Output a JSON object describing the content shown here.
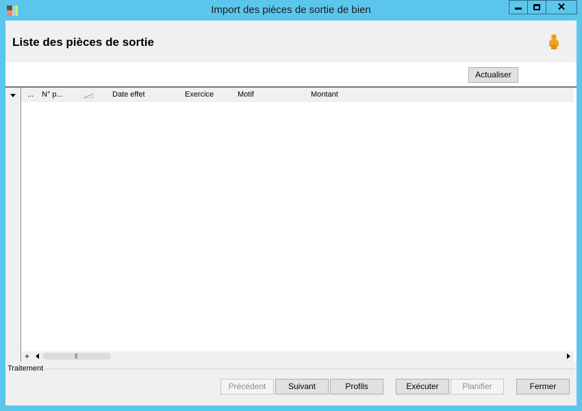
{
  "window": {
    "title": "Import des pièces de sortie de bien",
    "close_glyph": "✕"
  },
  "header": {
    "title": "Liste des pièces de sortie",
    "user_icon": "user-icon"
  },
  "toolbar": {
    "refresh_label": "Actualiser"
  },
  "grid": {
    "columns": [
      "...",
      "N° p...",
      "Date effet",
      "Exercice",
      "Motif",
      "Montant"
    ],
    "rows": [],
    "add_glyph": "+",
    "scroll_grip": "|||"
  },
  "footer": {
    "group_label": "Traitement",
    "buttons": {
      "previous": "Précédent",
      "next": "Suivant",
      "profiles": "Profils",
      "execute": "Exécuter",
      "schedule": "Planifier",
      "close": "Fermer"
    }
  },
  "colors": {
    "title_bar": "#5bc6ec",
    "header_bg": "#f0f0f0",
    "user_icon": "#f0a11a"
  }
}
